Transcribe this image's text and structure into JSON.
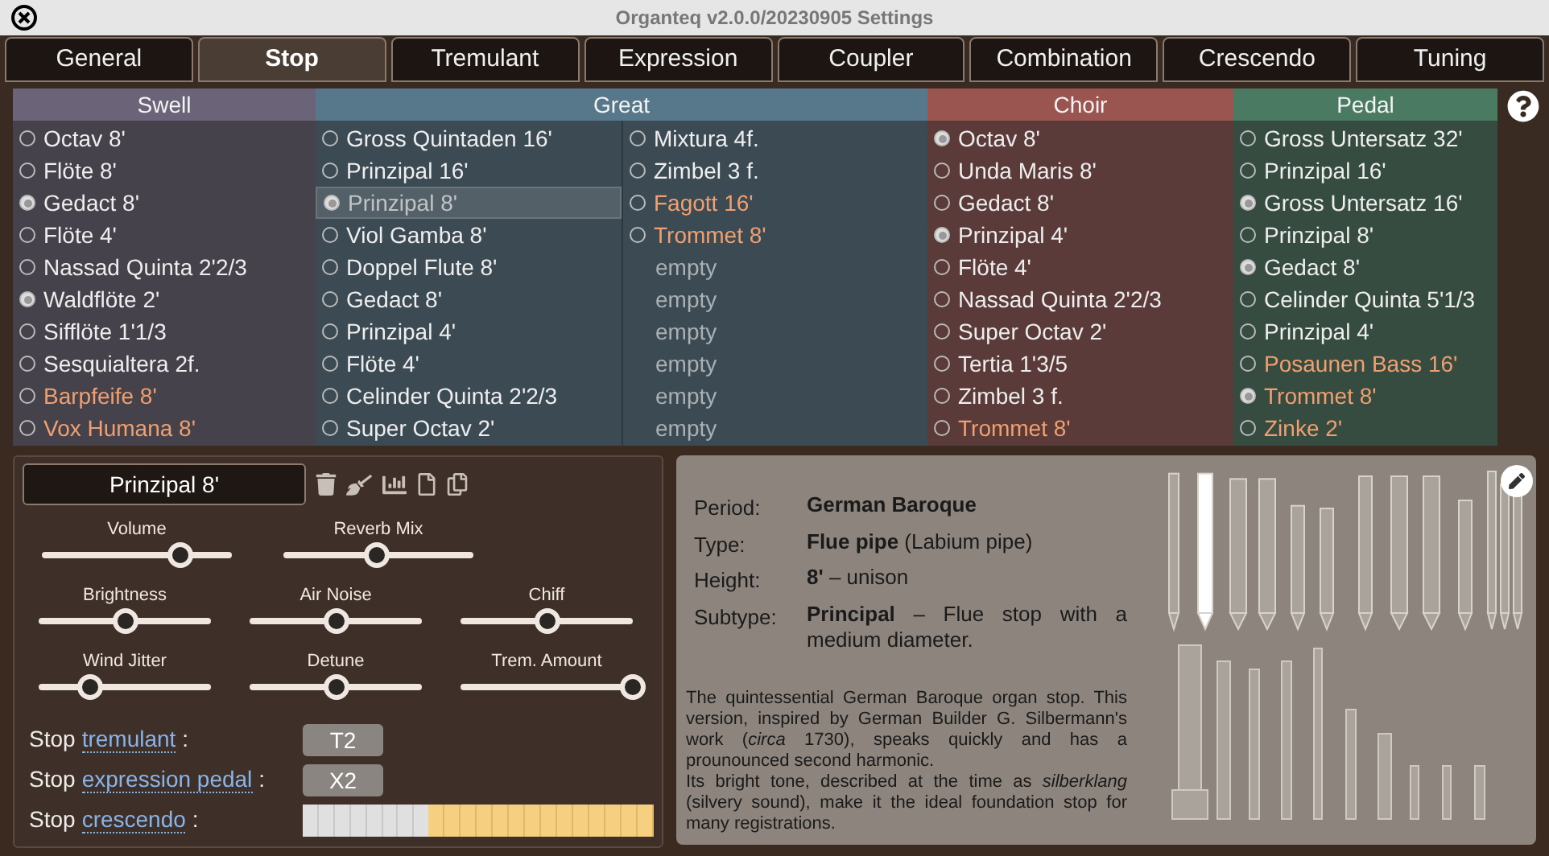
{
  "window": {
    "title": "Organteq v2.0.0/20230905 Settings"
  },
  "tabs": [
    {
      "label": "General",
      "selected": false
    },
    {
      "label": "Stop",
      "selected": true
    },
    {
      "label": "Tremulant",
      "selected": false
    },
    {
      "label": "Expression",
      "selected": false
    },
    {
      "label": "Coupler",
      "selected": false
    },
    {
      "label": "Combination",
      "selected": false
    },
    {
      "label": "Crescendo",
      "selected": false
    },
    {
      "label": "Tuning",
      "selected": false
    }
  ],
  "divisions": [
    {
      "name": "Swell",
      "color": "#6b6479",
      "columns": [
        [
          {
            "name": "Octav 8'",
            "kind": "flue",
            "selected": false,
            "current": false
          },
          {
            "name": "Flöte 8'",
            "kind": "flue",
            "selected": false,
            "current": false
          },
          {
            "name": "Gedact 8'",
            "kind": "flue",
            "selected": true,
            "current": false
          },
          {
            "name": "Flöte 4'",
            "kind": "flue",
            "selected": false,
            "current": false
          },
          {
            "name": "Nassad Quinta 2'2/3",
            "kind": "flue",
            "selected": false,
            "current": false
          },
          {
            "name": "Waldflöte 2'",
            "kind": "flue",
            "selected": true,
            "current": false
          },
          {
            "name": "Sifflöte 1'1/3",
            "kind": "flue",
            "selected": false,
            "current": false
          },
          {
            "name": "Sesquialtera 2f.",
            "kind": "flue",
            "selected": false,
            "current": false
          },
          {
            "name": "Barpfeife 8'",
            "kind": "reed",
            "selected": false,
            "current": false
          },
          {
            "name": "Vox Humana 8'",
            "kind": "reed",
            "selected": false,
            "current": false
          }
        ]
      ]
    },
    {
      "name": "Great",
      "color": "#56788a",
      "columns": [
        [
          {
            "name": "Gross Quintaden 16'",
            "kind": "flue",
            "selected": false,
            "current": false
          },
          {
            "name": "Prinzipal 16'",
            "kind": "flue",
            "selected": false,
            "current": false
          },
          {
            "name": "Prinzipal 8'",
            "kind": "flue",
            "selected": true,
            "current": true
          },
          {
            "name": "Viol Gamba 8'",
            "kind": "flue",
            "selected": false,
            "current": false
          },
          {
            "name": "Doppel Flute 8'",
            "kind": "flue",
            "selected": false,
            "current": false
          },
          {
            "name": "Gedact 8'",
            "kind": "flue",
            "selected": false,
            "current": false
          },
          {
            "name": "Prinzipal 4'",
            "kind": "flue",
            "selected": false,
            "current": false
          },
          {
            "name": "Flöte 4'",
            "kind": "flue",
            "selected": false,
            "current": false
          },
          {
            "name": "Celinder Quinta 2'2/3",
            "kind": "flue",
            "selected": false,
            "current": false
          },
          {
            "name": "Super Octav 2'",
            "kind": "flue",
            "selected": false,
            "current": false
          }
        ],
        [
          {
            "name": "Mixtura 4f.",
            "kind": "flue",
            "selected": false,
            "current": false
          },
          {
            "name": "Zimbel 3 f.",
            "kind": "flue",
            "selected": false,
            "current": false
          },
          {
            "name": "Fagott 16'",
            "kind": "reed",
            "selected": false,
            "current": false
          },
          {
            "name": "Trommet 8'",
            "kind": "reed",
            "selected": false,
            "current": false
          },
          {
            "name": "empty",
            "kind": "empty"
          },
          {
            "name": "empty",
            "kind": "empty"
          },
          {
            "name": "empty",
            "kind": "empty"
          },
          {
            "name": "empty",
            "kind": "empty"
          },
          {
            "name": "empty",
            "kind": "empty"
          },
          {
            "name": "empty",
            "kind": "empty"
          }
        ]
      ]
    },
    {
      "name": "Choir",
      "color": "#9b5551",
      "columns": [
        [
          {
            "name": "Octav 8'",
            "kind": "flue",
            "selected": true,
            "current": false
          },
          {
            "name": "Unda Maris 8'",
            "kind": "flue",
            "selected": false,
            "current": false
          },
          {
            "name": "Gedact 8'",
            "kind": "flue",
            "selected": false,
            "current": false
          },
          {
            "name": "Prinzipal 4'",
            "kind": "flue",
            "selected": true,
            "current": false
          },
          {
            "name": "Flöte 4'",
            "kind": "flue",
            "selected": false,
            "current": false
          },
          {
            "name": "Nassad Quinta 2'2/3",
            "kind": "flue",
            "selected": false,
            "current": false
          },
          {
            "name": "Super Octav 2'",
            "kind": "flue",
            "selected": false,
            "current": false
          },
          {
            "name": "Tertia 1'3/5",
            "kind": "flue",
            "selected": false,
            "current": false
          },
          {
            "name": "Zimbel 3 f.",
            "kind": "flue",
            "selected": false,
            "current": false
          },
          {
            "name": "Trommet 8'",
            "kind": "reed",
            "selected": false,
            "current": false
          }
        ]
      ]
    },
    {
      "name": "Pedal",
      "color": "#4a7a62",
      "columns": [
        [
          {
            "name": "Gross Untersatz 32'",
            "kind": "flue",
            "selected": false,
            "current": false
          },
          {
            "name": "Prinzipal 16'",
            "kind": "flue",
            "selected": false,
            "current": false
          },
          {
            "name": "Gross Untersatz 16'",
            "kind": "flue",
            "selected": true,
            "current": false
          },
          {
            "name": "Prinzipal 8'",
            "kind": "flue",
            "selected": false,
            "current": false
          },
          {
            "name": "Gedact 8'",
            "kind": "flue",
            "selected": true,
            "current": false
          },
          {
            "name": "Celinder Quinta 5'1/3",
            "kind": "flue",
            "selected": false,
            "current": false
          },
          {
            "name": "Prinzipal 4'",
            "kind": "flue",
            "selected": false,
            "current": false
          },
          {
            "name": "Posaunen Bass 16'",
            "kind": "reed",
            "selected": false,
            "current": false
          },
          {
            "name": "Trommet 8'",
            "kind": "reed",
            "selected": true,
            "current": false
          },
          {
            "name": "Zinke 2'",
            "kind": "reed",
            "selected": false,
            "current": false
          }
        ]
      ]
    }
  ],
  "editor": {
    "stop_name": "Prinzipal 8'",
    "sliders": [
      [
        {
          "label": "Volume",
          "level": 0.73
        },
        {
          "label": "Reverb Mix",
          "level": 0.49
        }
      ],
      [
        {
          "label": "Brightness",
          "level": 0.5
        },
        {
          "label": "Air Noise",
          "level": 0.5
        },
        {
          "label": "Chiff",
          "level": 0.5
        }
      ],
      [
        {
          "label": "Wind Jitter",
          "level": 0.3
        },
        {
          "label": "Detune",
          "level": 0.5
        },
        {
          "label": "Trem. Amount",
          "level": 1
        }
      ]
    ],
    "assignments": [
      {
        "kind": "button",
        "prefix": "Stop",
        "link": "tremulant",
        "suffix": ":",
        "value": "T2"
      },
      {
        "kind": "button",
        "prefix": "Stop",
        "link": "expression pedal",
        "suffix": ":",
        "value": "X2"
      },
      {
        "kind": "crescendo",
        "prefix": "Stop",
        "link": "crescendo",
        "suffix": ":",
        "level": 0.64
      }
    ]
  },
  "info": {
    "rows": [
      {
        "label": "Period:",
        "value": "**German Baroque**"
      },
      {
        "label": "Type:",
        "value": "**Flue pipe** (Labium pipe)"
      },
      {
        "label": "Height:",
        "value": "**8'** – unison"
      },
      {
        "label": "Subtype:",
        "value": "**Principal** – Flue stop with a medium diameter."
      }
    ],
    "description": [
      "The quintessential German Baroque organ stop. This version, inspired by German Builder G. Silbermann's work (*circa* 1730), speaks quickly and has a prounounced second harmonic.",
      "Its bright tone, described at the time as *silberklang* (silvery sound), make it the ideal foundation stop for many registrations."
    ]
  }
}
